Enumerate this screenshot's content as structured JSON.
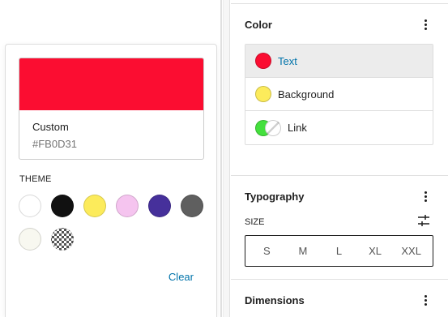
{
  "picker": {
    "selected_name": "Custom",
    "selected_hex": "#FB0D31",
    "preview_color": "#FB0D31",
    "theme_heading": "Theme",
    "swatches": [
      {
        "icon": "white-swatch",
        "color": "#FFFFFF"
      },
      {
        "icon": "black-swatch",
        "color": "#111111"
      },
      {
        "icon": "yellow-swatch",
        "color": "#FCEB5B"
      },
      {
        "icon": "pink-swatch",
        "color": "#F5C4EF"
      },
      {
        "icon": "purple-swatch",
        "color": "#46309B"
      },
      {
        "icon": "gray-swatch",
        "color": "#5F5F5F"
      },
      {
        "icon": "ivory-swatch",
        "color": "#F8F8F0"
      },
      {
        "icon": "checkered-swatch",
        "color": "transparent"
      }
    ],
    "clear_label": "Clear"
  },
  "sidebar": {
    "color_panel": {
      "title": "Color",
      "items": [
        {
          "label": "Text",
          "color": "#FB0D31",
          "active": true
        },
        {
          "label": "Background",
          "color": "#FCEB5B",
          "active": false
        },
        {
          "label": "Link",
          "color": "#44E03D",
          "color2": "#FFFFFF",
          "active": false
        }
      ]
    },
    "typography_panel": {
      "title": "Typography",
      "size_label": "Size",
      "size_options": [
        "S",
        "M",
        "L",
        "XL",
        "XXL"
      ]
    },
    "dimensions_panel": {
      "title": "Dimensions"
    }
  },
  "colors": {
    "accent": "#0073AA",
    "border": "#DDDDDD",
    "active_row": "#ECECEC"
  }
}
